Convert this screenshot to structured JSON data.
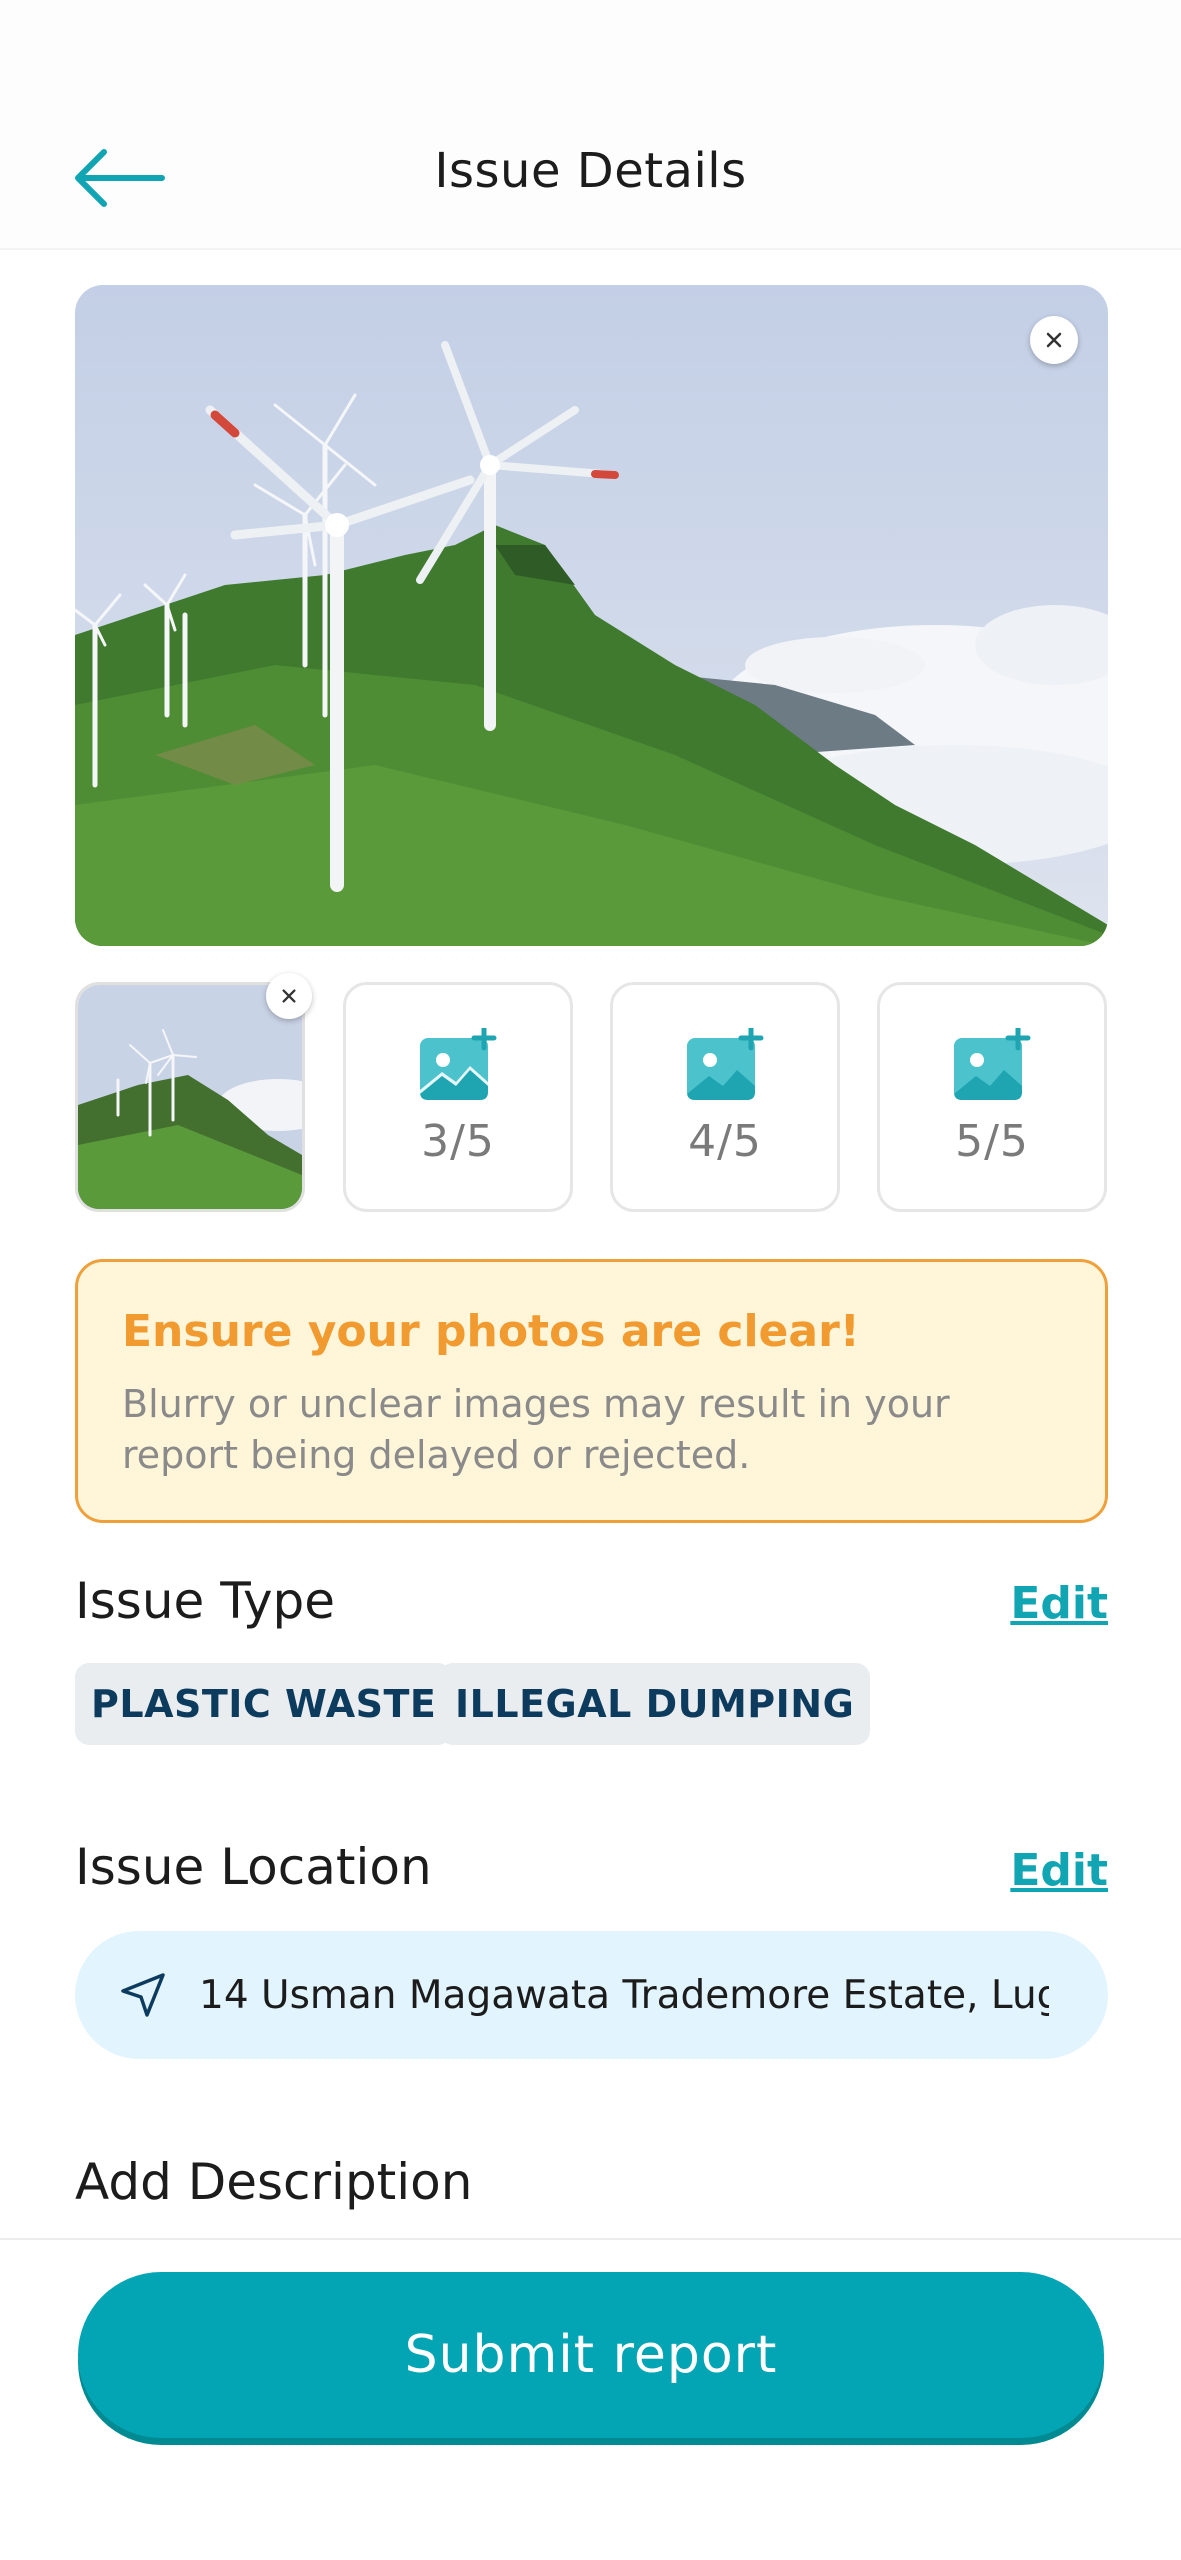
{
  "header": {
    "title": "Issue Details",
    "back_icon": "arrow-left-icon"
  },
  "photos": {
    "main_photo_alt": "Wind turbines on green hillside",
    "slots": [
      {
        "label": "3/5"
      },
      {
        "label": "4/5"
      },
      {
        "label": "5/5"
      }
    ]
  },
  "warning": {
    "title": "Ensure your photos are clear!",
    "text": "Blurry or unclear images may result in your report being delayed or rejected."
  },
  "issue_type": {
    "title": "Issue Type",
    "edit_label": "Edit",
    "tags": [
      "PLASTIC WASTE",
      "ILLEGAL DUMPING"
    ]
  },
  "issue_location": {
    "title": "Issue Location",
    "edit_label": "Edit",
    "address": "14 Usman Magawata Trademore Estate, Lug..."
  },
  "description": {
    "title": "Add Description"
  },
  "submit": {
    "label": "Submit report"
  },
  "colors": {
    "accent": "#03a4b3",
    "warning_border": "#f0a03a",
    "warning_bg": "#fff5d9",
    "tag_text": "#0c3b5e",
    "location_bg": "#e2f4fd"
  }
}
